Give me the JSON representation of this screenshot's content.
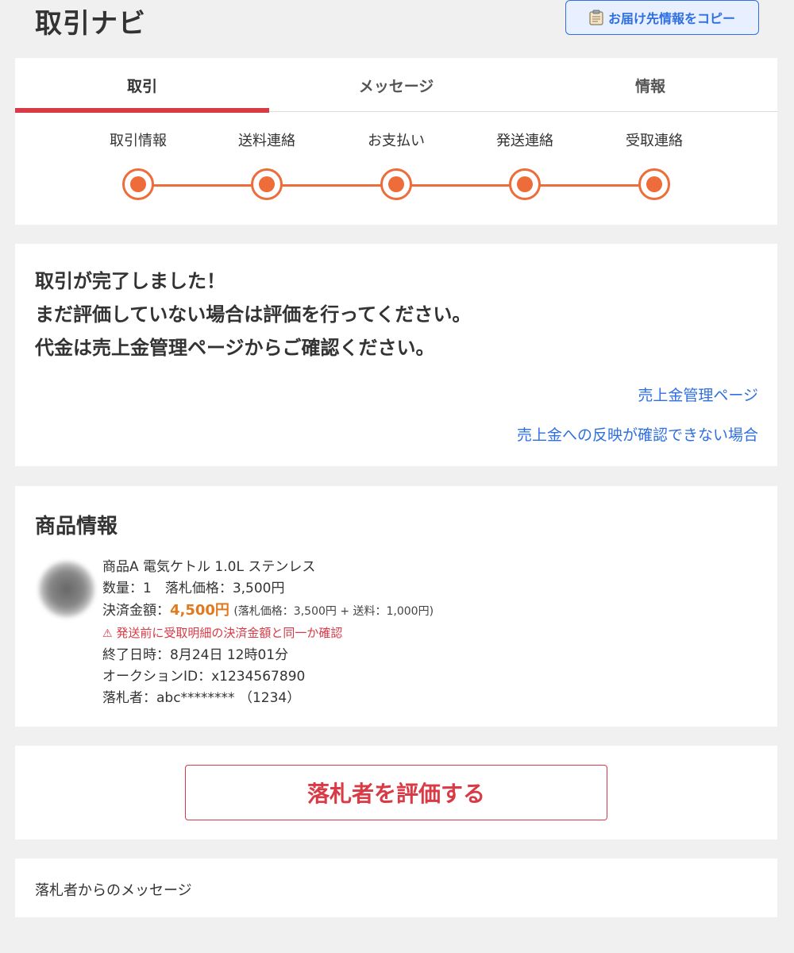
{
  "header": {
    "title": "取引ナビ",
    "copy_button": "お届け先情報をコピー",
    "copy_icon": "clipboard-icon"
  },
  "tabs": [
    {
      "label": "取引",
      "active": true
    },
    {
      "label": "メッセージ",
      "active": false
    },
    {
      "label": "情報",
      "active": false
    }
  ],
  "steps": [
    {
      "label": "取引情報",
      "done": true
    },
    {
      "label": "送料連絡",
      "done": true
    },
    {
      "label": "お支払い",
      "done": true
    },
    {
      "label": "発送連絡",
      "done": true
    },
    {
      "label": "受取連絡",
      "done": true
    }
  ],
  "completion": {
    "lines": [
      "取引が完了しました！",
      "まだ評価していない場合は評価を行ってください。",
      "代金は売上金管理ページからご確認ください。"
    ],
    "link_sales": "売上金管理ページ",
    "link_not_reflected": "売上金への反映が確認できない場合"
  },
  "product": {
    "section_title": "商品情報",
    "name": "商品A 電気ケトル 1.0L ステンレス",
    "quantity_line": "数量：1　落札価格：3,500円",
    "payment_label": "決済金額：",
    "payment_amount": "4,500円",
    "payment_breakdown": "(落札価格：3,500円 + 送料：1,000円)",
    "warning_icon": "⚠",
    "warning": "発送前に受取明細の決済金額と同一か確認",
    "end_time": "終了日時：8月24日 12時01分",
    "auction_id": "オークションID：x1234567890",
    "winner": "落札者：abc******** （1234）"
  },
  "rate_button": "落札者を評価する",
  "message_section": "落札者からのメッセージ",
  "colors": {
    "accent_red": "#d93a45",
    "step_orange": "#ee6b3a",
    "link_blue": "#2f6fe0",
    "amount_orange": "#e07a1f"
  }
}
